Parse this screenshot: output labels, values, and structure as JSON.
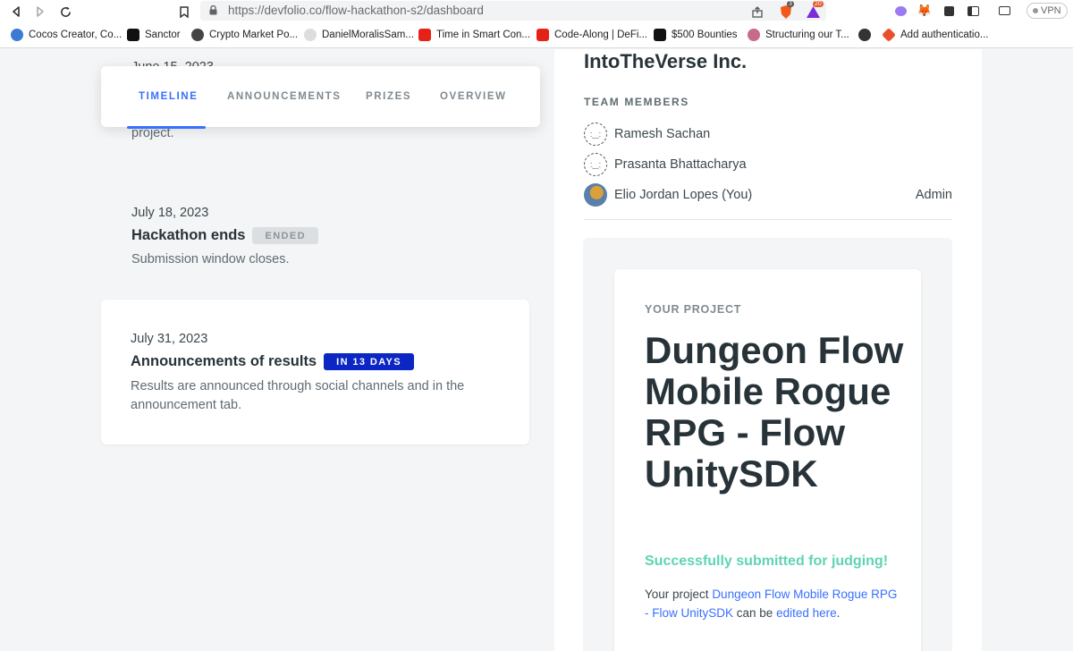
{
  "browser": {
    "url_host": "https://devfolio.co",
    "url_path": "/flow-hackathon-s2/dashboard",
    "brave_count": "3",
    "alert_count": "20",
    "vpn_label": "VPN"
  },
  "bookmarks": [
    {
      "label": "Cocos Creator, Co...",
      "color": "#3b7bd4"
    },
    {
      "label": "Sanctor",
      "color": "#111111"
    },
    {
      "label": "Crypto Market Po...",
      "color": "#444444"
    },
    {
      "label": "DanielMoralisSam...",
      "color": "#dddddd"
    },
    {
      "label": "Time in Smart Con...",
      "color": "#e62117"
    },
    {
      "label": "Code-Along | DeFi...",
      "color": "#e62117"
    },
    {
      "label": "$500 Bounties",
      "color": "#111111"
    },
    {
      "label": "Structuring our T...",
      "color": "#c76b8a"
    },
    {
      "label": "",
      "color": "#333333"
    },
    {
      "label": "Add authenticatio...",
      "color": "#e8502a"
    }
  ],
  "tabs": {
    "timeline": "TIMELINE",
    "announcements": "ANNOUNCEMENTS",
    "prizes": "PRIZES",
    "overview": "OVERVIEW"
  },
  "timeline": {
    "partial_date": "June 15, 2023",
    "partial_text": "project.",
    "items": [
      {
        "date": "July 18, 2023",
        "title": "Hackathon ends",
        "badge": "ENDED",
        "text": "Submission window closes."
      },
      {
        "date": "July 31, 2023",
        "title": "Announcements of results",
        "badge": "IN 13 DAYS",
        "text": "Results are announced through social channels and in the announcement tab."
      }
    ]
  },
  "team": {
    "name": "IntoTheVerse Inc.",
    "members_label": "TEAM MEMBERS",
    "members": [
      {
        "name": "Ramesh Sachan",
        "role": ""
      },
      {
        "name": "Prasanta Bhattacharya",
        "role": ""
      },
      {
        "name": "Elio Jordan Lopes (You)",
        "role": "Admin"
      }
    ]
  },
  "project": {
    "label": "YOUR PROJECT",
    "title": "Dungeon Flow Mobile Rogue RPG - Flow UnitySDK",
    "status": "Successfully submitted for judging!",
    "desc_prefix": "Your project ",
    "desc_link": "Dungeon Flow Mobile Rogue RPG - Flow UnitySDK",
    "desc_middle": " can be ",
    "desc_edit": "edited here",
    "desc_suffix": "."
  }
}
